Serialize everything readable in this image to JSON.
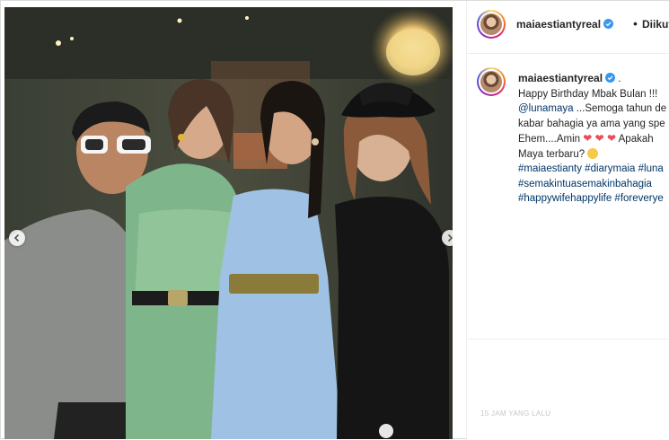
{
  "post": {
    "username": "maiaestiantyreal",
    "follow_status": "Diikuti",
    "separator": "•",
    "carousel": {
      "prev": "previous-arrow",
      "next": "next-arrow"
    }
  },
  "caption": {
    "username": "maiaestiantyreal",
    "username_suffix": " .",
    "line1": "Happy Birthday Mbak Bulan !!!",
    "mention": "@lunamaya",
    "line2_rest": " ...Semoga tahun de",
    "line3": "kabar bahagia ya ama yang spe",
    "line4_start": "Ehem....Amin ",
    "hearts": "❤ ❤ ❤",
    "line4_end": " Apakah",
    "line5": "Maya terbaru? ",
    "hashtags_line1": [
      "#maiaestianty",
      "#diarymaia",
      "#luna"
    ],
    "hashtags_line2": [
      "#semakintuasemakinbahagia"
    ],
    "hashtags_line3": [
      "#happywifehappylife",
      "#foreverye"
    ]
  },
  "timestamp": "15 JAM YANG LALU",
  "colors": {
    "link": "#003569",
    "heart": "#ed4956",
    "verified": "#3897f0",
    "text": "#262626"
  }
}
